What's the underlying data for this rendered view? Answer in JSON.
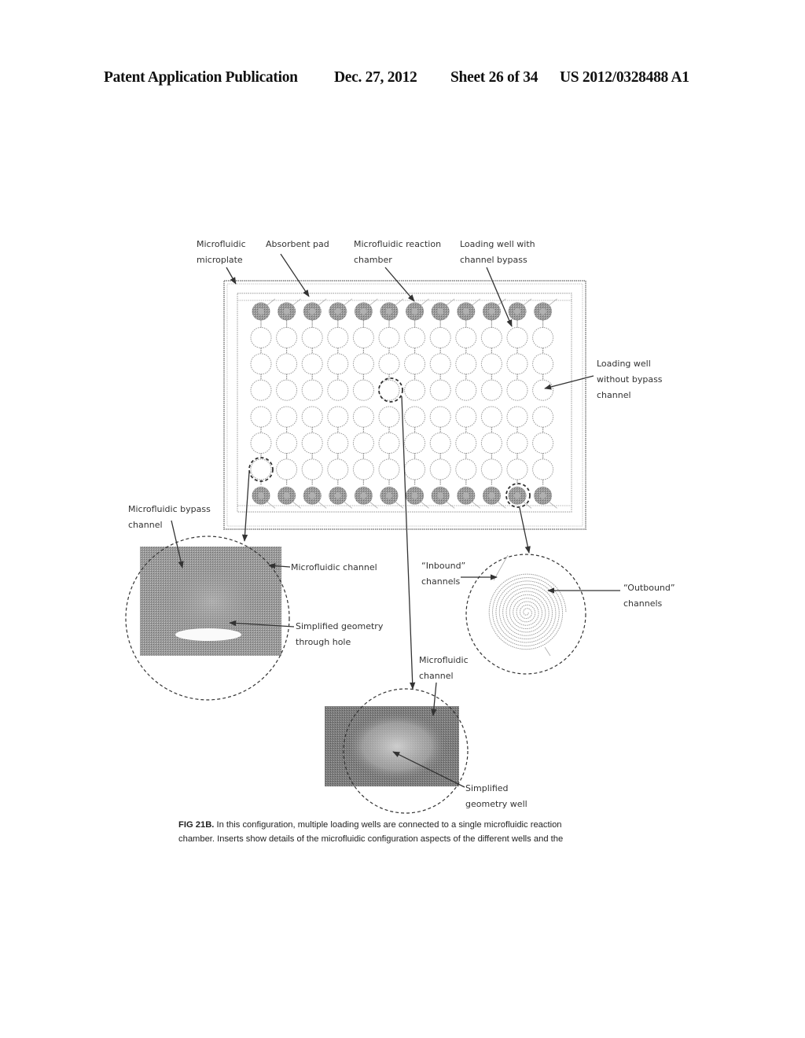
{
  "header": {
    "publication": "Patent Application Publication",
    "date": "Dec. 27, 2012",
    "sheet": "Sheet 26 of 34",
    "number": "US 2012/0328488 A1"
  },
  "figure": {
    "plate": {
      "columns": 12,
      "rows": 8,
      "chamber_rows": [
        0,
        7
      ],
      "row_gap_after": 3
    },
    "labels": {
      "microplate": [
        "Microfluidic",
        "microplate"
      ],
      "absorbent_pad": [
        "Absorbent pad"
      ],
      "reaction_chamber": [
        "Microfluidic reaction",
        "chamber"
      ],
      "loading_well_bypass": [
        "Loading well with",
        "channel bypass"
      ],
      "loading_well_no_bypass": [
        "Loading well",
        "without bypass",
        "channel"
      ],
      "bypass_channel": [
        "Microfluidic bypass",
        "channel"
      ],
      "inset1_channel": [
        "Microfluidic channel"
      ],
      "inset1_geometry": [
        "Simplified geometry",
        "through hole"
      ],
      "inbound": [
        "“Inbound”",
        "channels"
      ],
      "outbound": [
        "“Outbound”",
        "channels"
      ],
      "inset3_channel": [
        "Microfluidic",
        "channel"
      ],
      "inset3_geometry": [
        "Simplified",
        "geometry well"
      ]
    },
    "caption": {
      "figure_id": "FIG 21B.",
      "line1": " In this configuration, multiple loading wells are connected to a single microfluidic reaction",
      "line2": "chamber.  Inserts show details of the microfluidic configuration aspects of the different wells and the"
    }
  }
}
